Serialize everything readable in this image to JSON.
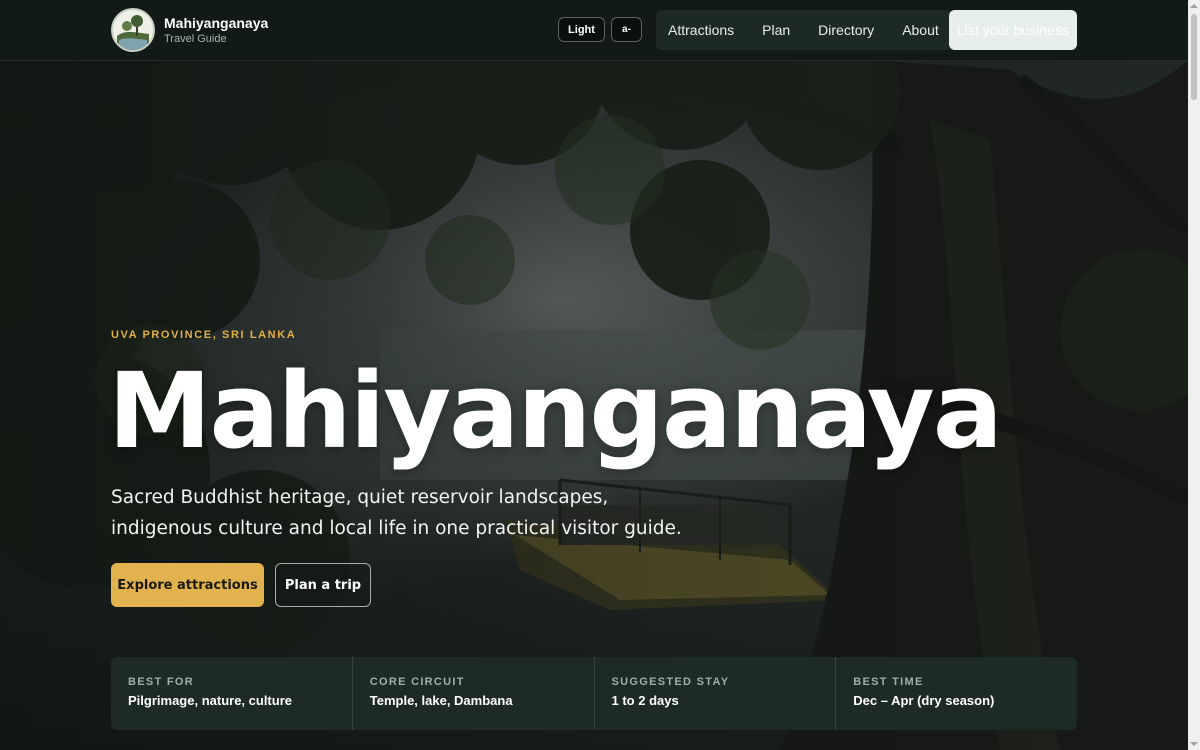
{
  "header": {
    "brand_name": "Mahiyanganaya",
    "brand_sub": "Travel Guide",
    "theme_toggle": "Light",
    "font_toggle": "a-",
    "nav": [
      "Attractions",
      "Plan",
      "Directory",
      "About"
    ],
    "cta": "List your business"
  },
  "hero": {
    "eyebrow": "UVA PROVINCE, SRI LANKA",
    "title": "Mahiyanganaya",
    "description": "Sacred Buddhist heritage, quiet reservoir landscapes, indigenous culture and local life in one practical visitor guide.",
    "primary_button": "Explore attractions",
    "secondary_button": "Plan a trip"
  },
  "facts": [
    {
      "label": "BEST FOR",
      "value": "Pilgrimage, nature, culture"
    },
    {
      "label": "CORE CIRCUIT",
      "value": "Temple, lake, Dambana"
    },
    {
      "label": "SUGGESTED STAY",
      "value": "1 to 2 days"
    },
    {
      "label": "BEST TIME",
      "value": "Dec – Apr (dry season)"
    }
  ],
  "colors": {
    "accent": "#e2b24e",
    "eyebrow": "#e3b046",
    "header_bg": "#121a17",
    "facts_bg": "#1e2c27"
  },
  "icons": {
    "logo": "landscape-logo-icon",
    "scroll_up": "chevron-up-icon",
    "scroll_down": "chevron-down-icon"
  }
}
